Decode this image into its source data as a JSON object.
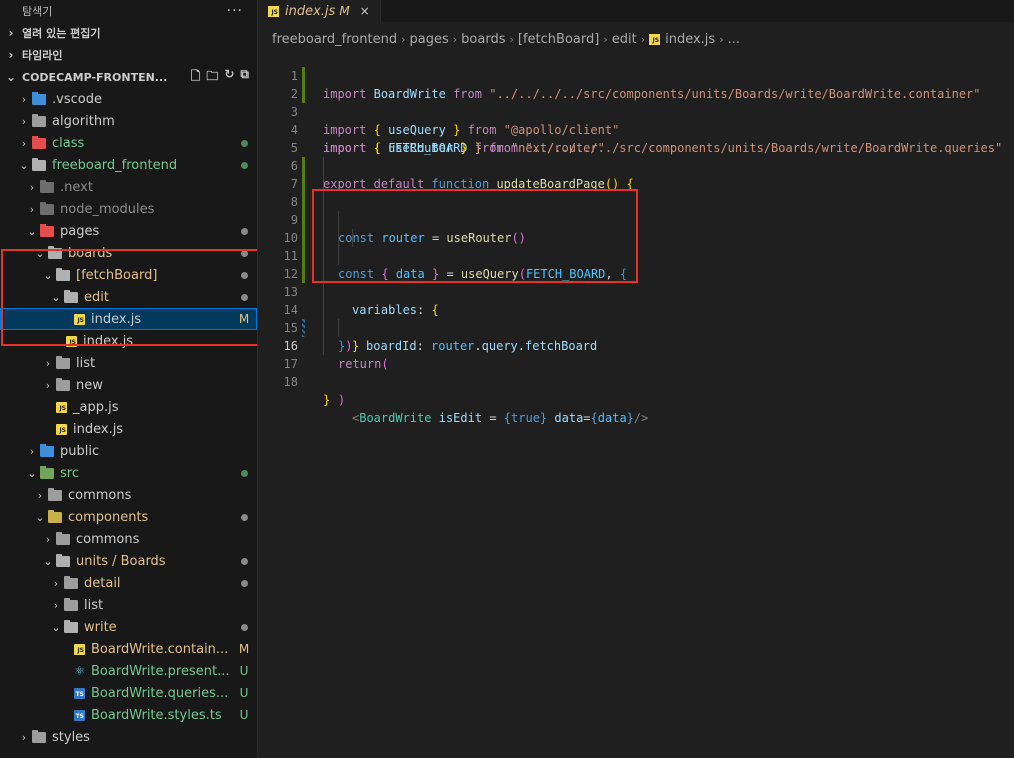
{
  "explorer": {
    "title": "탐색기",
    "more_label": "···",
    "open_editors": "열려 있는 편집기",
    "timeline": "타임라인",
    "project": "CODECAMP-FRONTEN..."
  },
  "tree": [
    {
      "label": ".vscode",
      "status": ""
    },
    {
      "label": "algorithm",
      "status": ""
    },
    {
      "label": "class",
      "status": ""
    },
    {
      "label": "freeboard_frontend",
      "status": ""
    },
    {
      "label": ".next",
      "status": ""
    },
    {
      "label": "node_modules",
      "status": ""
    },
    {
      "label": "pages",
      "status": ""
    },
    {
      "label": "boards",
      "status": ""
    },
    {
      "label": "[fetchBoard]",
      "status": ""
    },
    {
      "label": "edit",
      "status": ""
    },
    {
      "label": "index.js",
      "status": "M"
    },
    {
      "label": "index.js",
      "status": ""
    },
    {
      "label": "list",
      "status": ""
    },
    {
      "label": "new",
      "status": ""
    },
    {
      "label": "_app.js",
      "status": ""
    },
    {
      "label": "index.js",
      "status": ""
    },
    {
      "label": "public",
      "status": ""
    },
    {
      "label": "src",
      "status": ""
    },
    {
      "label": "commons",
      "status": ""
    },
    {
      "label": "components",
      "status": ""
    },
    {
      "label": "commons",
      "status": ""
    },
    {
      "label": "units / Boards",
      "status": ""
    },
    {
      "label": "detail",
      "status": ""
    },
    {
      "label": "list",
      "status": ""
    },
    {
      "label": "write",
      "status": ""
    },
    {
      "label": "BoardWrite.contain...",
      "status": "M"
    },
    {
      "label": "BoardWrite.present...",
      "status": "U"
    },
    {
      "label": "BoardWrite.queries...",
      "status": "U"
    },
    {
      "label": "BoardWrite.styles.ts",
      "status": "U"
    },
    {
      "label": "styles",
      "status": ""
    }
  ],
  "tab": {
    "icon": "JS",
    "label": "index.js",
    "status": "M",
    "close": "×"
  },
  "breadcrumb": [
    "freeboard_frontend",
    "pages",
    "boards",
    "[fetchBoard]",
    "edit",
    "index.js",
    "..."
  ],
  "code": {
    "line_numbers": [
      "1",
      "2",
      "3",
      "4",
      "5",
      "6",
      "7",
      "8",
      "9",
      "10",
      "11",
      "12",
      "13",
      "14",
      "15",
      "16",
      "17",
      "18"
    ],
    "imports": {
      "import": "import",
      "from": "from",
      "board_write": "BoardWrite",
      "path1": "\"../../../../src/components/units/Boards/write/BoardWrite.container\"",
      "use_query": "useQuery",
      "path2": "\"@apollo/client\"",
      "fetch_board": "FETCH_BOARD",
      "path3": "\"../../../../src/components/units/Boards/write/BoardWrite.queries\"",
      "use_router": "useRouter",
      "path4": "\"next/router\""
    },
    "kw": {
      "export": "export",
      "default": "default",
      "function": "function",
      "const": "const",
      "return": "return",
      "true": "true"
    },
    "names": {
      "fn": "updateBoardPage",
      "router": "router",
      "data": "data",
      "variables": "variables",
      "board_id": "boardId",
      "query": "query",
      "fetch_board_prop": "fetchBoard",
      "is_edit": "isEdit",
      "data_attr": "data"
    }
  },
  "colors": {
    "highlight": "#e5332a",
    "selection": "#04395e",
    "modified": "#e2c08d",
    "untracked": "#73c991"
  }
}
